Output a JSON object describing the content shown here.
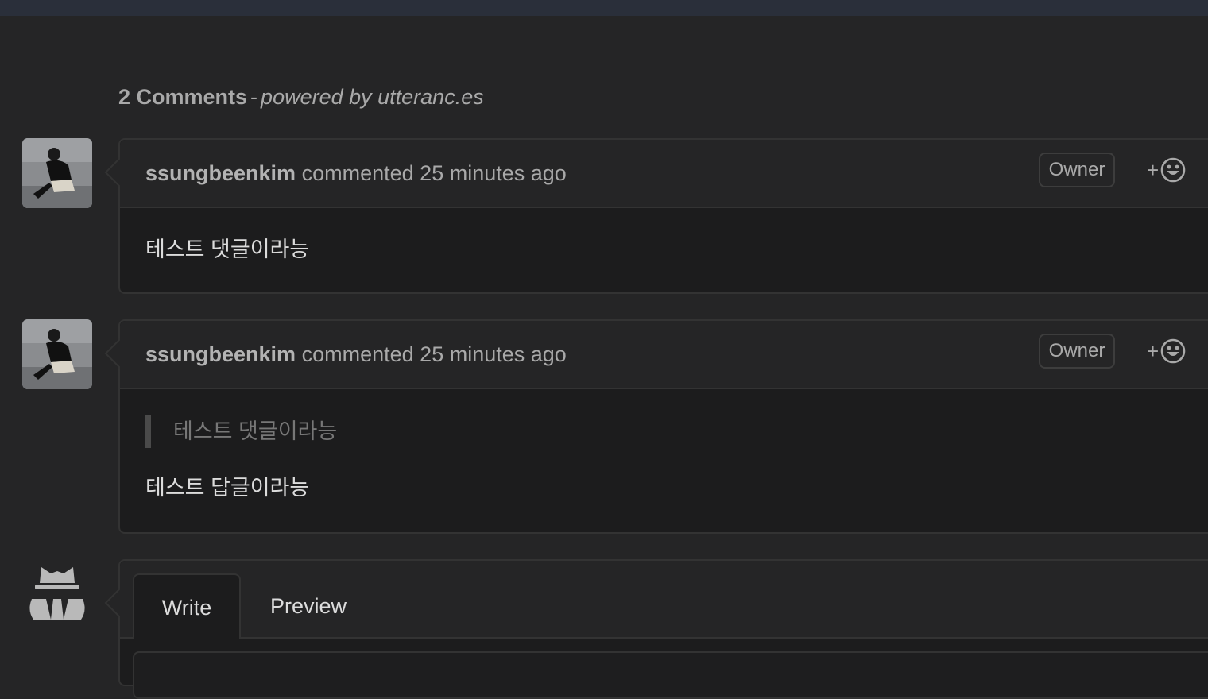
{
  "header": {
    "count": "2 Comments",
    "separator": "-",
    "powered_by": "powered by utteranc.es"
  },
  "comments": [
    {
      "author": "ssungbeenkim",
      "action": "commented",
      "time": "25 minutes ago",
      "badge": "Owner",
      "reaction_plus": "+",
      "body": "테스트 댓글이라능"
    },
    {
      "author": "ssungbeenkim",
      "action": "commented",
      "time": "25 minutes ago",
      "badge": "Owner",
      "reaction_plus": "+",
      "quote": "테스트 댓글이라능",
      "body": "테스트 답글이라능"
    }
  ],
  "editor": {
    "tabs": [
      "Write",
      "Preview"
    ]
  },
  "icons": {
    "reaction": "smiley-icon",
    "anonymous": "incognito-icon"
  },
  "colors": {
    "background": "#252526",
    "card_body": "#1c1c1d",
    "border": "#333333",
    "muted_text": "#a9a9a9"
  }
}
